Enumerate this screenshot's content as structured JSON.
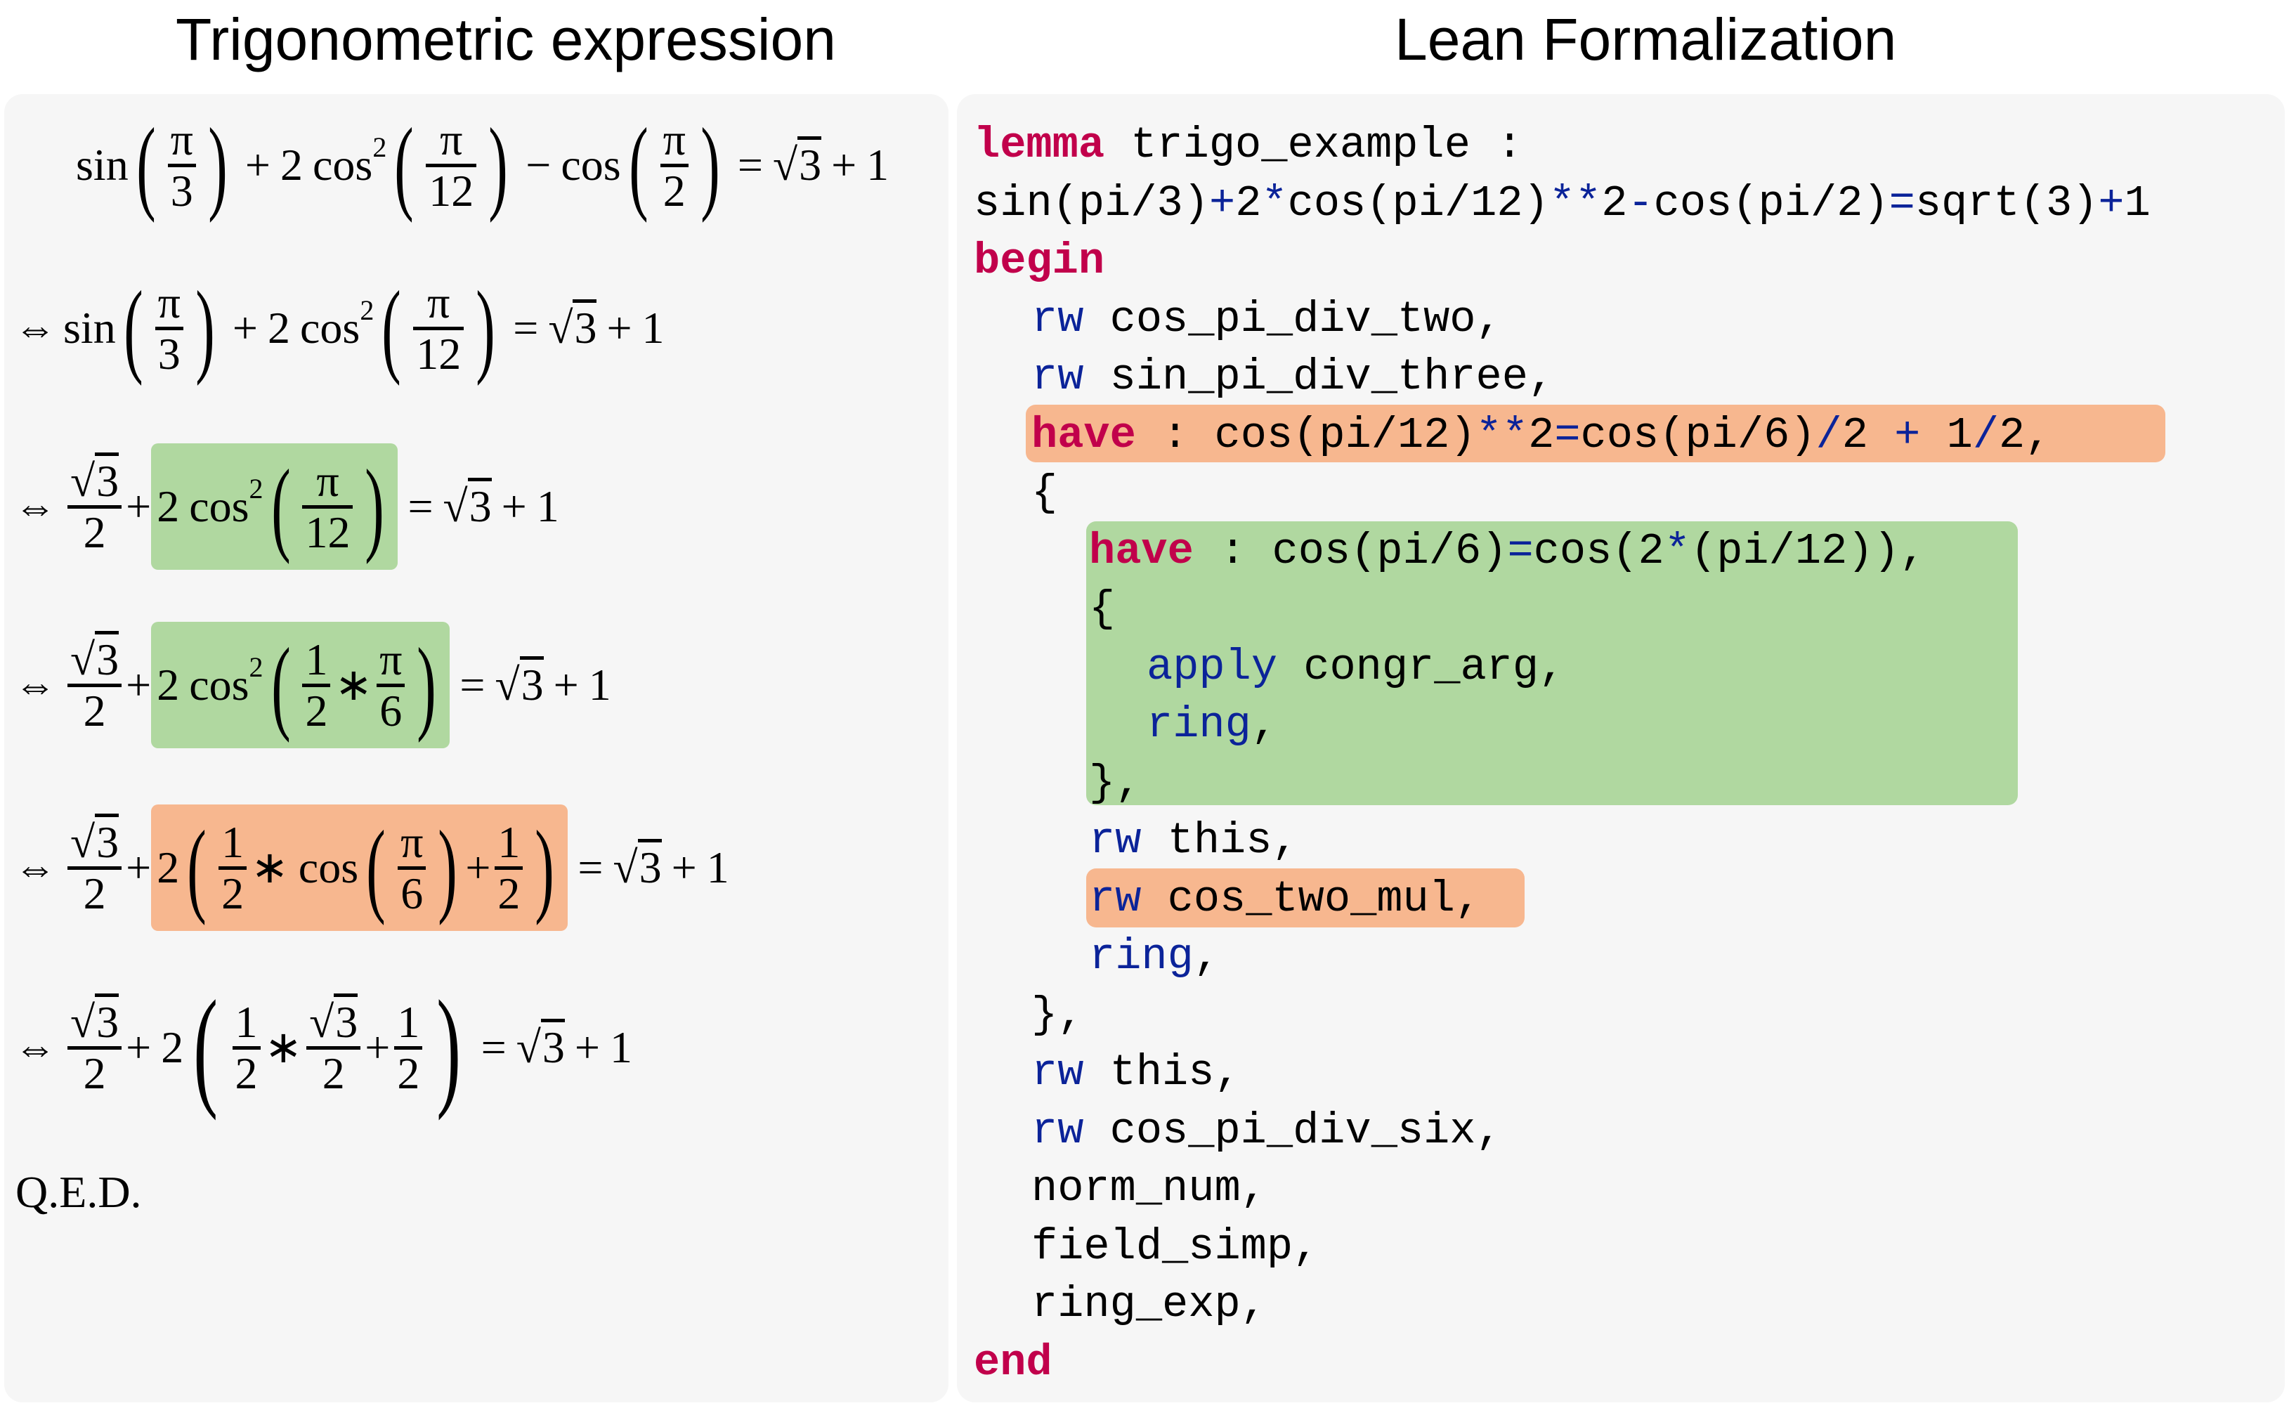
{
  "titles": {
    "left": "Trigonometric expression",
    "right": "Lean Formalization"
  },
  "colors": {
    "panel_bg": "#f6f6f6",
    "highlight_green": "#b0d8a0",
    "highlight_orange": "#f7b78f",
    "keyword_red": "#c1004b",
    "keyword_blue": "#0b2399"
  },
  "math_steps": [
    {
      "latex": "\\sin\\left(\\frac{\\pi}{3}\\right) + 2\\cos^2\\left(\\frac{\\pi}{12}\\right) - \\cos\\left(\\frac{\\pi}{2}\\right) = \\sqrt{3} + 1",
      "highlight": "none"
    },
    {
      "latex": "\\Leftrightarrow \\sin\\left(\\frac{\\pi}{3}\\right) + 2\\cos^2\\left(\\frac{\\pi}{12}\\right) = \\sqrt{3} + 1",
      "highlight": "none"
    },
    {
      "latex": "\\Leftrightarrow \\frac{\\sqrt{3}}{2} + 2\\cos^2\\left(\\frac{\\pi}{12}\\right) = \\sqrt{3} + 1",
      "highlight": "green",
      "highlighted_part": "2cos^2(pi/12)"
    },
    {
      "latex": "\\Leftrightarrow \\frac{\\sqrt{3}}{2} + 2\\cos^2\\left(\\frac{1}{2} * \\frac{\\pi}{6}\\right) = \\sqrt{3} + 1",
      "highlight": "green",
      "highlighted_part": "2cos^2(1/2 * pi/6)"
    },
    {
      "latex": "\\Leftrightarrow \\frac{\\sqrt{3}}{2} + 2\\left(\\frac{1}{2} * \\cos\\left(\\frac{\\pi}{6}\\right) + \\frac{1}{2}\\right) = \\sqrt{3} + 1",
      "highlight": "orange",
      "highlighted_part": "2(1/2 * cos(pi/6) + 1/2)"
    },
    {
      "latex": "\\Leftrightarrow \\frac{\\sqrt{3}}{2} + 2\\left(\\frac{1}{2} * \\frac{\\sqrt{3}}{2} + \\frac{1}{2}\\right) = \\sqrt{3} + 1",
      "highlight": "none"
    }
  ],
  "math_tokens": {
    "sin": "sin",
    "cos": "cos",
    "pi": "π",
    "iff": "⇔",
    "plus": "+",
    "minus": "−",
    "eq": "=",
    "times": "∗",
    "sqrt": "√",
    "two": "2",
    "three": "3",
    "one": "1",
    "six": "6",
    "twelve": "12",
    "sq": "2",
    "lp": "(",
    "rp": ")"
  },
  "qed": "Q.E.D.",
  "lean": {
    "lines": [
      {
        "indent": 0,
        "kw": "lemma",
        "kw_class": "red",
        "rest": " trigo_example :"
      },
      {
        "indent": 0,
        "raw": "sin(pi/3)+2*cos(pi/12)**2-cos(pi/2)=sqrt(3)+1"
      },
      {
        "indent": 0,
        "kw": "begin",
        "kw_class": "red",
        "rest": ""
      },
      {
        "indent": 1,
        "kw": "rw",
        "kw_class": "blue",
        "rest": " cos_pi_div_two,"
      },
      {
        "indent": 1,
        "kw": "rw",
        "kw_class": "blue",
        "rest": " sin_pi_div_three,"
      },
      {
        "indent": 1,
        "kw": "have",
        "kw_class": "red",
        "rest": " : cos(pi/12)**2=cos(pi/6)/2 + 1/2,",
        "highlight": "orange"
      },
      {
        "indent": 1,
        "raw": "{"
      },
      {
        "indent": 2,
        "kw": "have",
        "kw_class": "red",
        "rest": " : cos(pi/6)=cos(2*(pi/12)),",
        "highlight": "green"
      },
      {
        "indent": 2,
        "raw": "{",
        "highlight": "green"
      },
      {
        "indent": 3,
        "kw": "apply",
        "kw_class": "blue",
        "rest": " congr_arg,",
        "highlight": "green"
      },
      {
        "indent": 3,
        "kw": "ring",
        "kw_class": "blue",
        "rest": ",",
        "highlight": "green"
      },
      {
        "indent": 2,
        "raw": "},",
        "highlight": "green"
      },
      {
        "indent": 2,
        "kw": "rw",
        "kw_class": "blue",
        "rest": " this,"
      },
      {
        "indent": 2,
        "kw": "rw",
        "kw_class": "blue",
        "rest": " cos_two_mul,",
        "highlight": "orange"
      },
      {
        "indent": 2,
        "kw": "ring",
        "kw_class": "blue",
        "rest": ","
      },
      {
        "indent": 1,
        "raw": "},"
      },
      {
        "indent": 1,
        "kw": "rw",
        "kw_class": "blue",
        "rest": " this,"
      },
      {
        "indent": 1,
        "kw": "rw",
        "kw_class": "blue",
        "rest": " cos_pi_div_six,"
      },
      {
        "indent": 1,
        "raw": "norm_num,"
      },
      {
        "indent": 1,
        "raw": "field_simp,"
      },
      {
        "indent": 1,
        "raw": "ring_exp,"
      },
      {
        "indent": 0,
        "kw": "end",
        "kw_class": "red",
        "rest": ""
      }
    ]
  }
}
